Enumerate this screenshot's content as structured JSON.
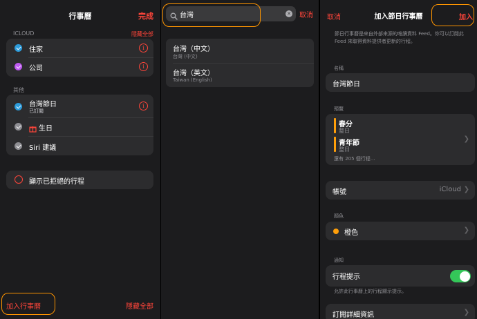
{
  "left_panel": {
    "title": "行事曆",
    "done": "完成",
    "icloud_section": "ICLOUD",
    "hide_all_top": "隱藏全部",
    "icloud_items": [
      {
        "label": "住家",
        "color": "#2d9cdb"
      },
      {
        "label": "公司",
        "color": "#bf5af2"
      }
    ],
    "other_section": "其他",
    "other_items": [
      {
        "label": "台灣節日",
        "sub": "已訂閱",
        "color": "#2d9cdb"
      },
      {
        "label": "生日",
        "color": "#8e8e93"
      },
      {
        "label": "Siri 建議",
        "color": "#8e8e93"
      }
    ],
    "show_declined": "顯示已拒絕的行程",
    "add_calendar": "加入行事曆",
    "hide_all_bottom": "隱藏全部"
  },
  "search_panel": {
    "query": "台灣",
    "cancel": "取消",
    "results": [
      {
        "title": "台灣（中文）",
        "sub": "台灣 (中文)"
      },
      {
        "title": "台灣（英文）",
        "sub": "Taiwan (English)"
      }
    ]
  },
  "add_panel": {
    "cancel": "取消",
    "title": "加入節日行事曆",
    "add": "加入",
    "description": "節日行事曆是來自外部來源的唯讀資料 Feed。你可以訂閱此 Feed 來取得資料提供者更新的行程。",
    "name_label": "名稱",
    "name_value": "台灣節日",
    "preview_label": "預覽",
    "preview_events": [
      {
        "title": "春分",
        "sub": "整日"
      },
      {
        "title": "青年節",
        "sub": "整日"
      }
    ],
    "preview_more": "還有 205 個行程…",
    "account_label": "帳號",
    "account_value": "iCloud",
    "color_section": "顏色",
    "color_name": "橙色",
    "color_value": "#ff9f0a",
    "notify_section": "通知",
    "event_alerts_label": "行程提示",
    "event_alerts_on": true,
    "event_alerts_note": "允許此行事曆上的行程顯示提示。",
    "subscription_details": "訂閱詳細資訊"
  }
}
